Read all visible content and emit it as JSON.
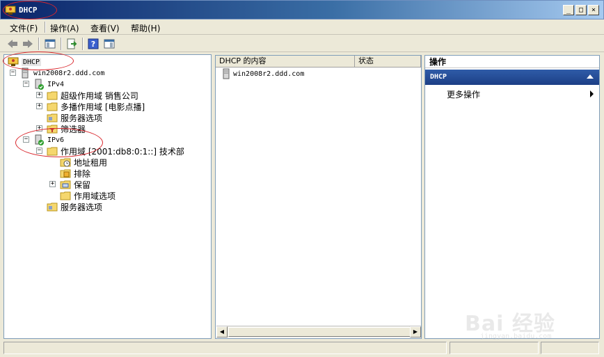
{
  "window": {
    "title": "DHCP",
    "minimize": "_",
    "maximize": "□",
    "close": "×"
  },
  "menu": {
    "file": "文件(F)",
    "action": "操作(A)",
    "view": "查看(V)",
    "help": "帮助(H)"
  },
  "toolbar": {
    "icons": [
      "back-icon",
      "forward-icon",
      "show-hide-tree-icon",
      "export-list-icon",
      "help-icon",
      "show-hide-action-pane-icon"
    ]
  },
  "tree": {
    "root": "DHCP",
    "server": "win2008r2.ddd.com",
    "ipv4": "IPv4",
    "superscope": "超级作用域 销售公司",
    "multicast": "多播作用域 [电影点播]",
    "ipv4_server_options": "服务器选项",
    "filters": "筛选器",
    "ipv6": "IPv6",
    "scope": "作用域 [2001:db8:0:1::] 技术部",
    "leases": "地址租用",
    "exclusions": "排除",
    "reservations": "保留",
    "scope_options": "作用域选项",
    "ipv6_server_options": "服务器选项"
  },
  "list": {
    "col_name": "DHCP 的内容",
    "col_status": "状态",
    "rows": [
      {
        "name": "win2008r2.ddd.com",
        "status": ""
      }
    ]
  },
  "actions": {
    "header": "操作",
    "section": "DHCP",
    "more": "更多操作"
  },
  "watermark": {
    "brand": "Bai 经验",
    "url": "jingyan.baidu.com"
  },
  "colors": {
    "title_bar": "#0a246a",
    "action_section": "#1c3f86",
    "annotation": "#d9262c"
  }
}
